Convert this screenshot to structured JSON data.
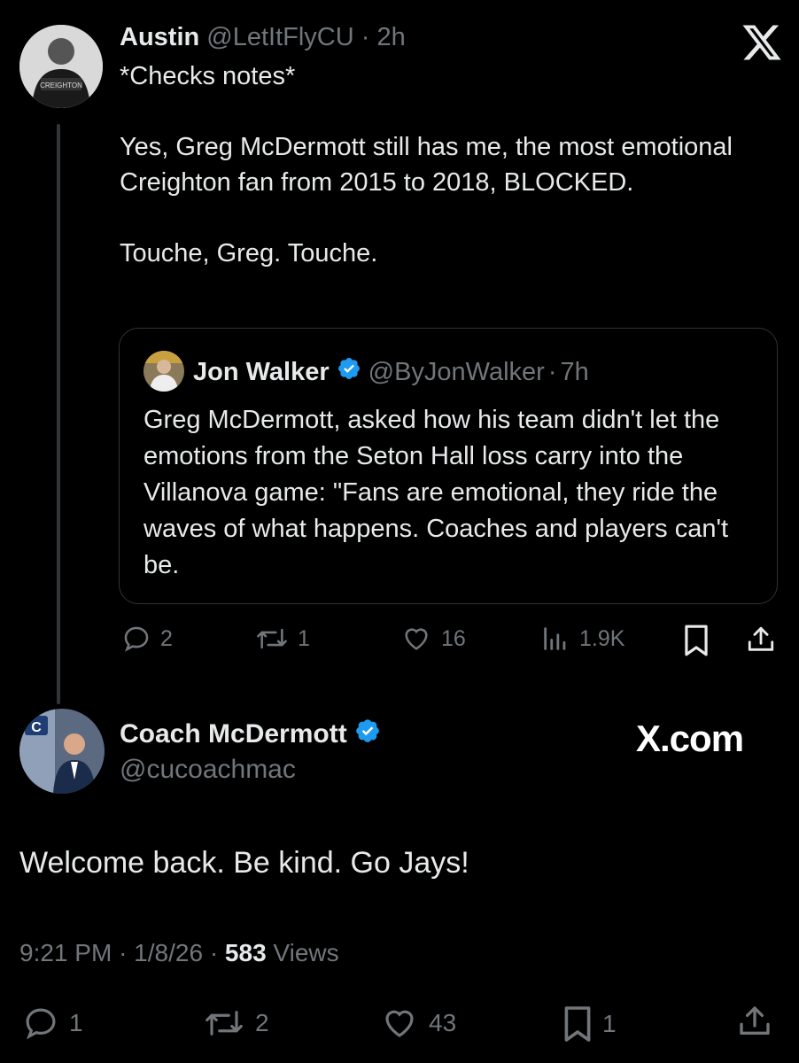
{
  "tweet1": {
    "name": "Austin",
    "handle": "@LetItFlyCU",
    "separator": "·",
    "time": "2h",
    "body": "*Checks notes*\n\nYes, Greg McDermott still has me, the most emotional Creighton fan from 2015 to 2018, BLOCKED.\n\nTouche, Greg. Touche.",
    "quote": {
      "name": "Jon Walker",
      "handle": "@ByJonWalker",
      "separator": "·",
      "time": "7h",
      "body": "Greg McDermott, asked how his team didn't let the emotions from the Seton Hall loss carry into the Villanova game: \"Fans are emotional, they ride the waves of what happens. Coaches and players can't be."
    },
    "actions": {
      "replies": "2",
      "reposts": "1",
      "likes": "16",
      "views": "1.9K"
    }
  },
  "tweet2": {
    "name": "Coach McDermott",
    "handle": "@cucoachmac",
    "body": "Welcome back. Be kind. Go Jays!",
    "time": "9:21 PM",
    "date": "1/8/26",
    "separator": "·",
    "views_count": "583",
    "views_label": "Views",
    "actions": {
      "replies": "1",
      "reposts": "2",
      "likes": "43",
      "bookmarks": "1"
    }
  },
  "watermark": "X.com",
  "colors": {
    "background": "#000000",
    "text": "#e7e9ea",
    "muted": "#71767b",
    "verified": "#1d9bf0",
    "border": "#2f3336"
  }
}
